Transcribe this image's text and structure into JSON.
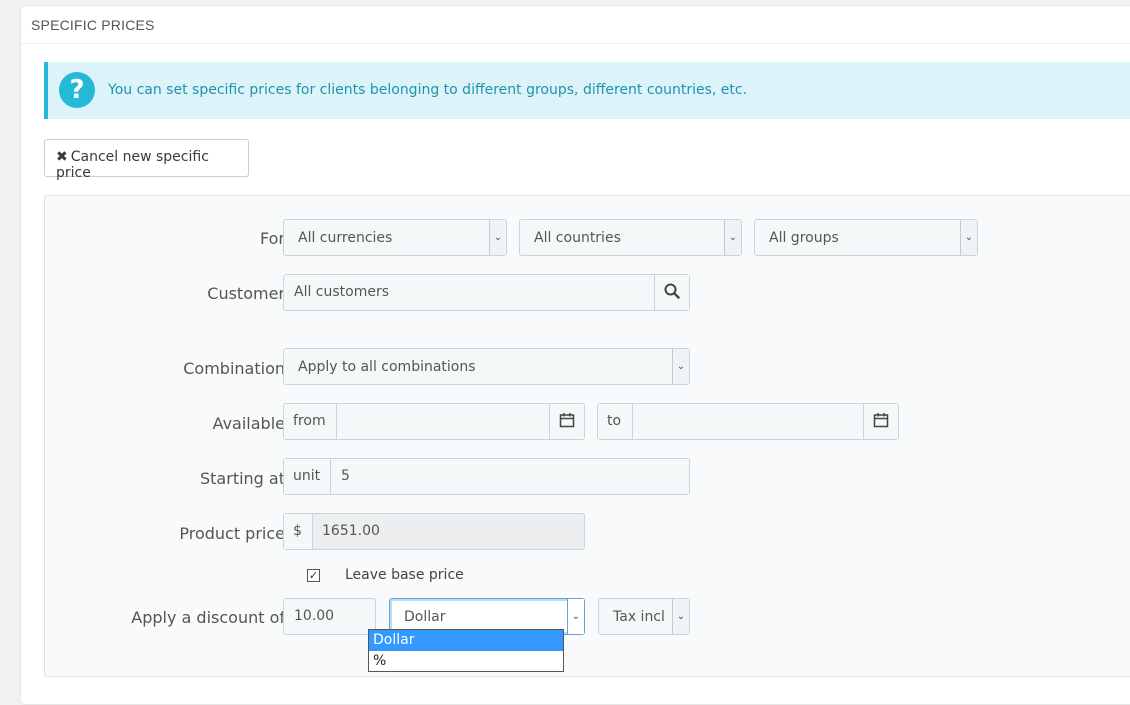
{
  "panel": {
    "title": "SPECIFIC PRICES"
  },
  "alert": {
    "icon": "question-icon",
    "text": "You can set specific prices for clients belonging to different groups, different countries, etc."
  },
  "cancel_button": {
    "icon": "close-icon",
    "label": "Cancel new specific price"
  },
  "form": {
    "for": {
      "label": "For",
      "currency": "All currencies",
      "country": "All countries",
      "group": "All groups"
    },
    "customer": {
      "label": "Customer",
      "value": "All customers",
      "icon": "search-icon"
    },
    "combination": {
      "label": "Combination",
      "value": "Apply to all combinations"
    },
    "available": {
      "label": "Available",
      "from_label": "from",
      "from_value": "",
      "to_label": "to",
      "to_value": "",
      "icon": "calendar-icon"
    },
    "starting_at": {
      "label": "Starting at",
      "unit_label": "unit",
      "value": "5"
    },
    "product_price": {
      "label": "Product price",
      "currency_symbol": "$",
      "value": "1651.00"
    },
    "leave_base_price": {
      "label": "Leave base price",
      "checked": true
    },
    "discount": {
      "label": "Apply a discount of",
      "value": "10.00",
      "type_selected": "Dollar",
      "type_options": [
        "Dollar",
        "%"
      ],
      "tax": "Tax incl"
    }
  },
  "colors": {
    "accent": "#25b9d7",
    "alert_bg": "#dcf4f9",
    "selected_option": "#3399ff"
  }
}
